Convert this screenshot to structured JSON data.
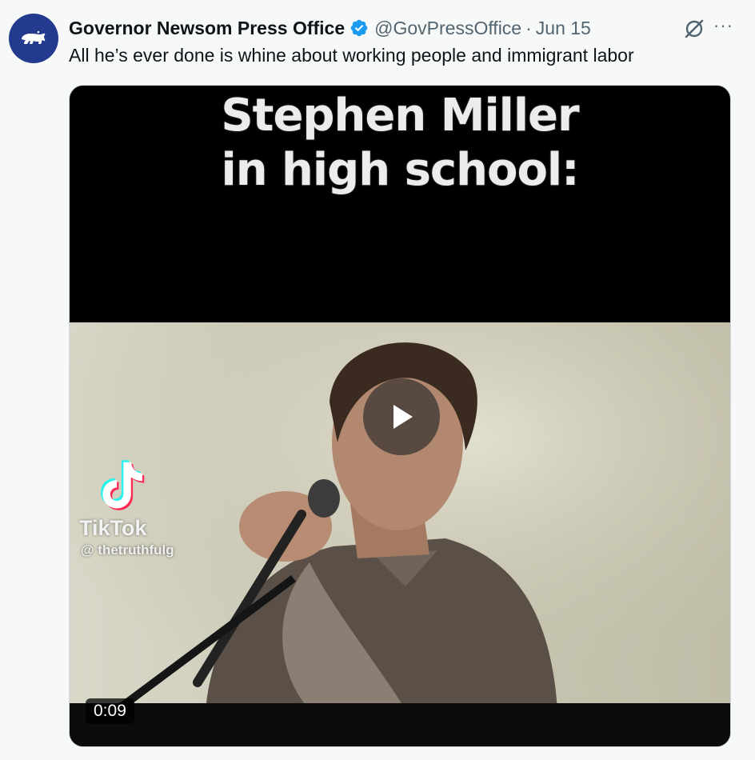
{
  "tweet": {
    "author_name": "Governor Newsom Press Office",
    "handle": "@GovPressOffice",
    "separator": "·",
    "date": "Jun 15",
    "text": "All he’s ever done is whine about working people and immigrant labor",
    "verified": true,
    "icons": [
      "bear-avatar-icon",
      "verified-badge-icon",
      "grok-icon",
      "more-icon"
    ]
  },
  "media": {
    "type": "video",
    "caption_line1": "Stephen Miller",
    "caption_line2": "in high school:",
    "watermark_brand": "TikTok",
    "watermark_handle": "@ thetruthfulg",
    "duration": "0:09",
    "play_icon": "play-icon"
  },
  "colors": {
    "background": "#f7f9f9",
    "avatar": "#243a8f",
    "verified": "#1d9bf0",
    "secondary_text": "#536471"
  }
}
